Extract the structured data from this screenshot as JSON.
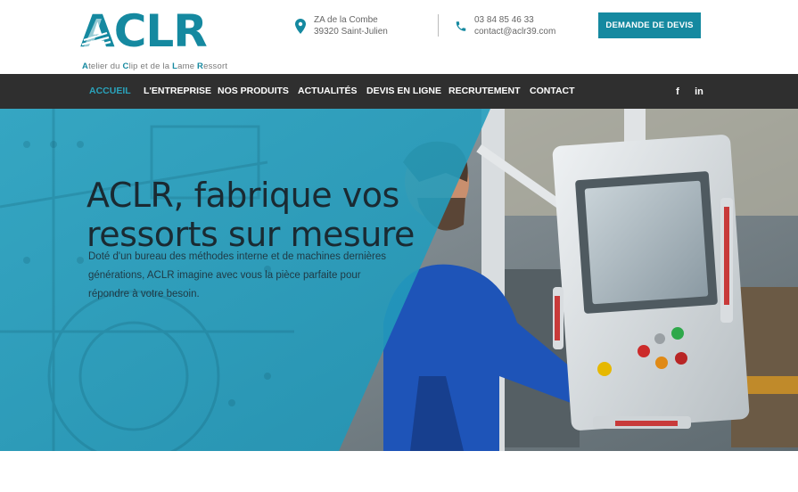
{
  "brand": {
    "name": "ACLR",
    "tagline": "Atelier du Clip et de la Lame Ressort",
    "color": "#1589a0"
  },
  "contact": {
    "address_line1": "ZA de la Combe",
    "address_line2": "39320 Saint-Julien",
    "phone": "03 84 85 46 33",
    "email": "contact@aclr39.com",
    "address_icon": "map-pin-icon",
    "phone_icon": "phone-icon"
  },
  "cta": {
    "quote_label": "DEMANDE DE DEVIS"
  },
  "nav": {
    "items": [
      {
        "label": "ACCUEIL",
        "active": true
      },
      {
        "label": "L'ENTREPRISE",
        "active": false
      },
      {
        "label": "NOS PRODUITS",
        "active": false
      },
      {
        "label": "ACTUALITÉS",
        "active": false
      },
      {
        "label": "DEVIS EN LIGNE",
        "active": false
      },
      {
        "label": "RECRUTEMENT",
        "active": false
      },
      {
        "label": "CONTACT",
        "active": false
      }
    ],
    "social": [
      {
        "label": "f",
        "icon": "facebook-icon"
      },
      {
        "label": "in",
        "icon": "linkedin-icon"
      }
    ],
    "background": "#2f2f2f",
    "active_color": "#2aa3bb"
  },
  "hero": {
    "title_line1": "ACLR, fabrique vos",
    "title_line2": "ressorts sur mesure",
    "text": "Doté d'un bureau des méthodes interne et de machines dernières générations, ACLR imagine avec vous la pièce parfaite pour répondre à votre besoin.",
    "overlay_color": "#2aa3c4"
  }
}
